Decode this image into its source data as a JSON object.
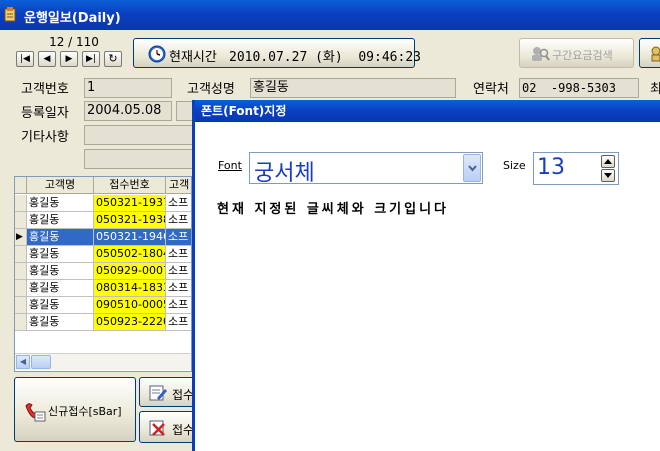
{
  "window": {
    "title": "운행일보(Daily)"
  },
  "nav": {
    "counter": "12 / 110",
    "first": "|◀",
    "prev": "◀",
    "next": "▶",
    "last": "▶|",
    "refresh": "↻"
  },
  "clock": {
    "label": "현재시간",
    "value": "2010.07.27 (화)  09:46:23"
  },
  "toolbar": {
    "fare_search": "구간요금검색"
  },
  "customer": {
    "number_label": "고객번호",
    "number": "1",
    "name_label": "고객성명",
    "name": "홍길동",
    "phone_label": "연락처",
    "phone": "02  -998-5303",
    "extra_label": "최",
    "regdate_label": "등록일자",
    "regdate": "2004.05.08",
    "notes_label": "기타사항"
  },
  "grid": {
    "headers": [
      "고객명",
      "접수번호",
      "고객"
    ],
    "rows": [
      {
        "name": "홍길동",
        "receipt": "050321-1937",
        "c": "소프",
        "yellow": true
      },
      {
        "name": "홍길동",
        "receipt": "050321-1938",
        "c": "소프",
        "yellow": true
      },
      {
        "name": "홍길동",
        "receipt": "050321-1946",
        "c": "소프",
        "yellow": false,
        "selected": true
      },
      {
        "name": "홍길동",
        "receipt": "050502-1804",
        "c": "소프",
        "yellow": true
      },
      {
        "name": "홍길동",
        "receipt": "050929-0007",
        "c": "소프",
        "yellow": true
      },
      {
        "name": "홍길동",
        "receipt": "080314-1833",
        "c": "소프",
        "yellow": true
      },
      {
        "name": "홍길동",
        "receipt": "090510-0005",
        "c": "소프",
        "yellow": true
      },
      {
        "name": "홍길동",
        "receipt": "050923-2220",
        "c": "소프",
        "yellow": true
      }
    ]
  },
  "buttons": {
    "new_receipt": "신규접수[sBar]",
    "receipt1": "접수",
    "receipt2": "접수"
  },
  "font_dialog": {
    "title": "폰트(Font)지정",
    "font_label": "Font",
    "font_value": "궁서체",
    "size_label": "Size",
    "size_value": "13",
    "preview": "현재 지정된 글씨체와 크기입니다"
  },
  "colors": {
    "accent": "#0a3fc0",
    "highlight": "#ffff00",
    "selection": "#3169c6"
  }
}
